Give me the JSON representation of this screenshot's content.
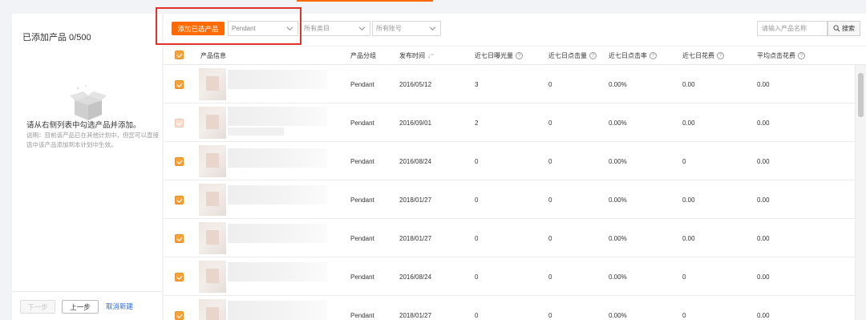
{
  "left": {
    "title": "已添加产品 0/500",
    "empty_message": "请从右侧列表中勾选产品并添加。",
    "empty_note": "说明：目前该产品已在其他计划中，但您可以直接选中该产品添加到本计划中生效。",
    "next_label": "下一步",
    "prev_label": "上一步",
    "cancel_label": "取消新建"
  },
  "toolbar": {
    "add_label": "添加已选产品",
    "group_value": "Pendant",
    "category_placeholder": "所有类目",
    "account_placeholder": "所有账号",
    "search_placeholder": "请输入产品名称",
    "search_label": "搜索"
  },
  "table": {
    "headers": {
      "info": "产品信息",
      "group": "产品分组",
      "published": "发布时间",
      "impressions": "近七日曝光量",
      "clicks": "近七日点击量",
      "ctr": "近七日点击率",
      "cost": "近七日花费",
      "avg_cpc": "平均点击花费"
    },
    "rows": [
      {
        "group": "Pendant",
        "date": "2016/05/12",
        "impressions": "3",
        "clicks": "0",
        "ctr": "0.00%",
        "cost": "0.00",
        "avg": "0.00",
        "checked": true
      },
      {
        "group": "Pendant",
        "date": "2016/09/01",
        "impressions": "2",
        "clicks": "0",
        "ctr": "0.00%",
        "cost": "0.00",
        "avg": "0.00",
        "checked": false
      },
      {
        "group": "Pendant",
        "date": "2016/08/24",
        "impressions": "0",
        "clicks": "0",
        "ctr": "0.00%",
        "cost": "0",
        "avg": "0.00",
        "checked": true
      },
      {
        "group": "Pendant",
        "date": "2018/01/27",
        "impressions": "0",
        "clicks": "0",
        "ctr": "0.00%",
        "cost": "0.00",
        "avg": "0.00",
        "checked": true
      },
      {
        "group": "Pendant",
        "date": "2018/01/27",
        "impressions": "0",
        "clicks": "0",
        "ctr": "0.00%",
        "cost": "0.00",
        "avg": "0.00",
        "checked": true
      },
      {
        "group": "Pendant",
        "date": "2016/08/24",
        "impressions": "0",
        "clicks": "0",
        "ctr": "0.00%",
        "cost": "0",
        "avg": "0.00",
        "checked": true
      },
      {
        "group": "Pendant",
        "date": "2018/01/27",
        "impressions": "0",
        "clicks": "0",
        "ctr": "0.00%",
        "cost": "0",
        "avg": "0.00",
        "checked": true
      }
    ]
  },
  "colors": {
    "accent": "#ff6a00",
    "checkbox": "#f6a33b",
    "highlight_box": "#e0322b",
    "link": "#2a6ad8"
  },
  "icons": {
    "empty_state": "open-box-icon",
    "search": "search-icon",
    "help": "question-circle-icon",
    "sort": "sort-icon",
    "dropdown": "chevron-down-icon"
  }
}
